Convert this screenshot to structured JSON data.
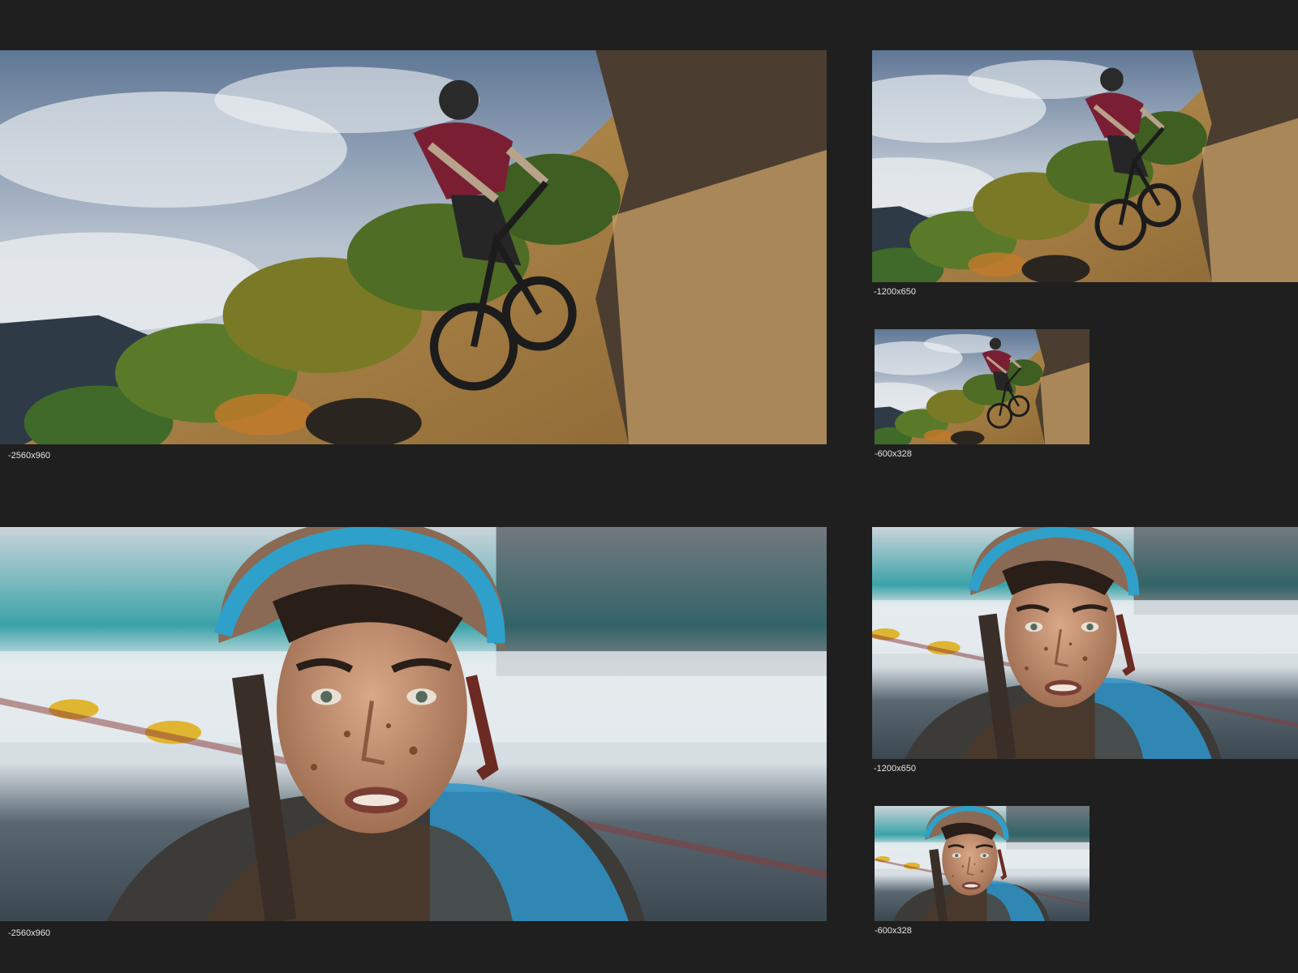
{
  "gallery": {
    "rows": [
      {
        "subject": "mountain-biker",
        "sizes": [
          {
            "label": "-2560x960"
          },
          {
            "label": "-1200x650"
          },
          {
            "label": "-600x328"
          }
        ]
      },
      {
        "subject": "muddy-rider-portrait",
        "sizes": [
          {
            "label": "-2560x960"
          },
          {
            "label": "-1200x650"
          },
          {
            "label": "-600x328"
          }
        ]
      }
    ]
  },
  "colors": {
    "background": "#1f1f1f",
    "caption_text": "#e6e6e6"
  }
}
